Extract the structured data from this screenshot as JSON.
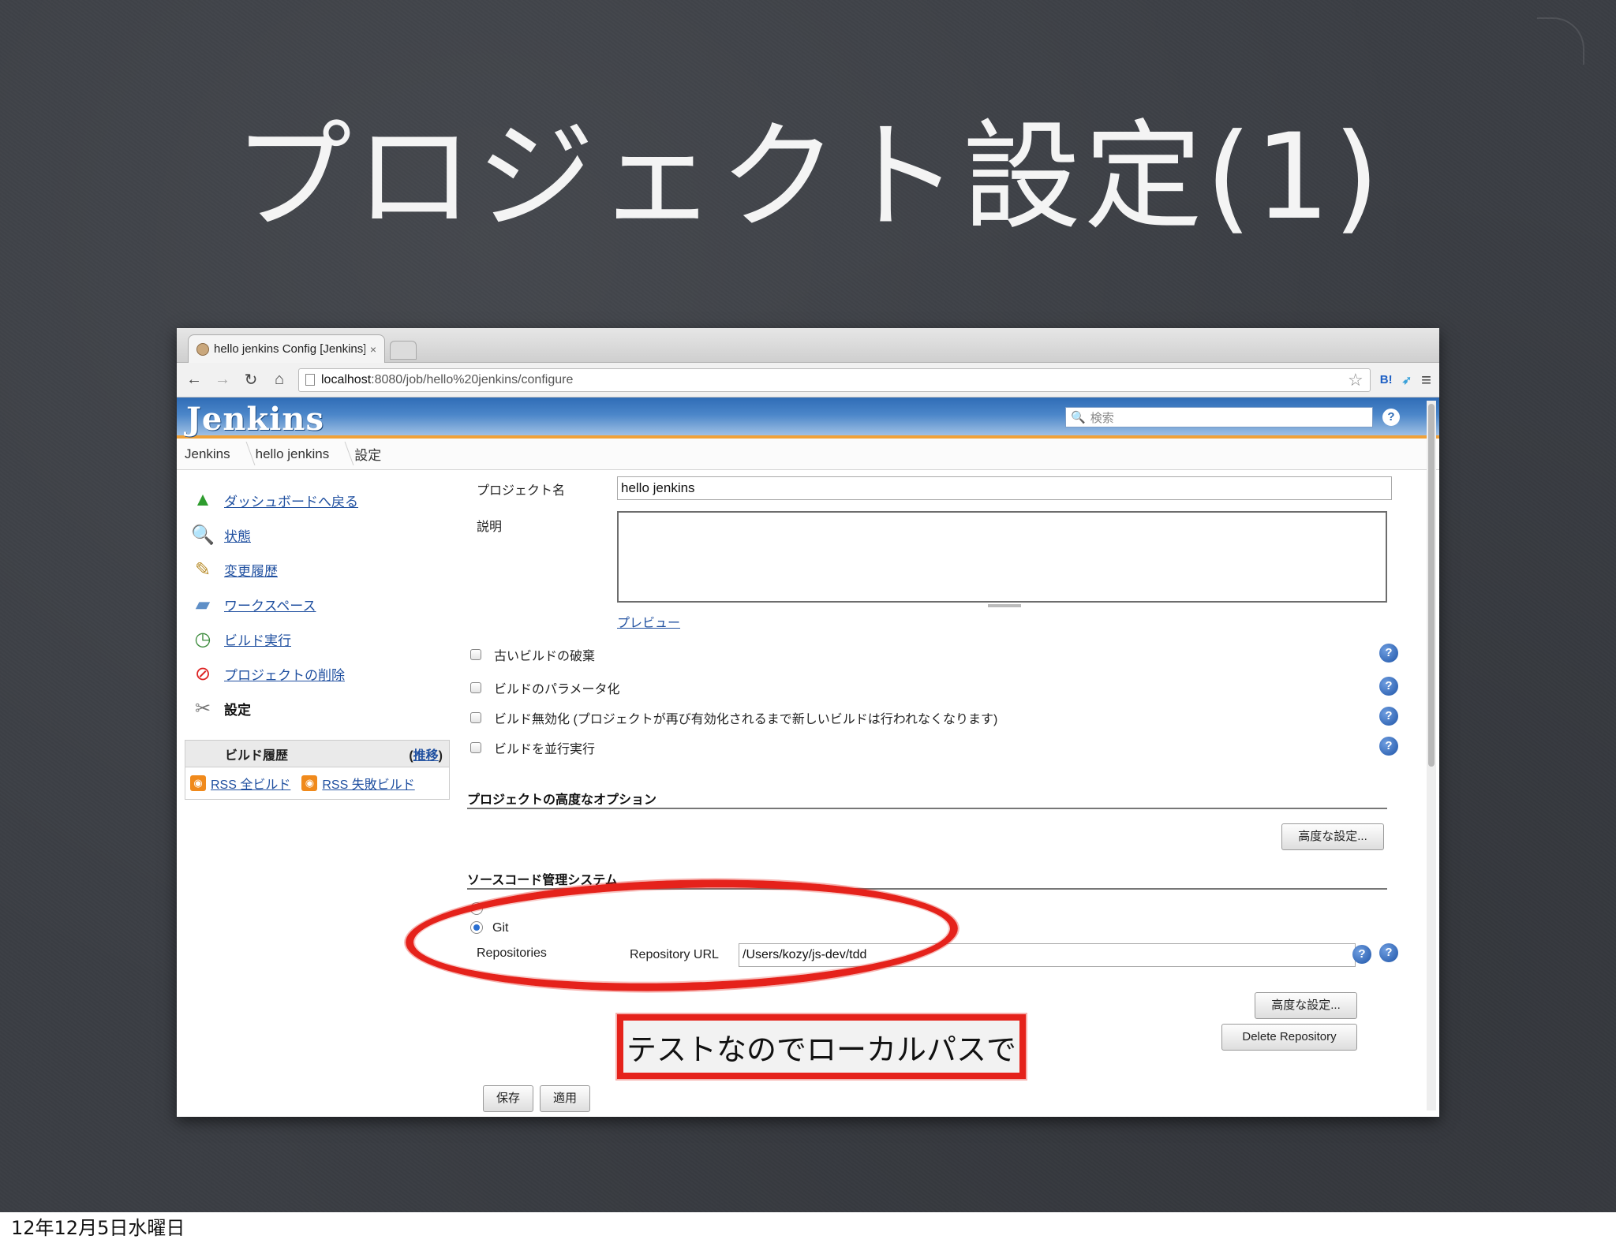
{
  "slide": {
    "title": "プロジェクト設定(1)",
    "footer_date": "12年12月5日水曜日"
  },
  "browser": {
    "tab_title": "hello jenkins Config [Jenkins]",
    "tab_close": "×",
    "url_host": "localhost",
    "url_path": ":8080/job/hello%20jenkins/configure",
    "ext_hatena": "B!",
    "ext_bird": "➶"
  },
  "jenkins": {
    "logo": "Jenkins",
    "search_placeholder": "検索",
    "breadcrumbs": [
      "Jenkins",
      "hello jenkins",
      "設定"
    ],
    "side_items": [
      {
        "label": "ダッシュボードへ戻る",
        "icon": "up-arrow-icon"
      },
      {
        "label": "状態",
        "icon": "search-icon"
      },
      {
        "label": "変更履歴",
        "icon": "notepad-icon"
      },
      {
        "label": "ワークスペース",
        "icon": "folder-icon"
      },
      {
        "label": "ビルド実行",
        "icon": "build-clock-icon"
      },
      {
        "label": "プロジェクトの削除",
        "icon": "no-entry-icon"
      },
      {
        "label": "設定",
        "icon": "tools-icon"
      }
    ],
    "build_history": {
      "title": "ビルド履歴",
      "trend_open": "(",
      "trend": "推移",
      "trend_close": ")",
      "rss_all": "RSS 全ビルド",
      "rss_failed": "RSS 失敗ビルド"
    },
    "form": {
      "project_name_label": "プロジェクト名",
      "project_name_value": "hello jenkins",
      "description_label": "説明",
      "preview": "プレビュー",
      "options": [
        "古いビルドの破棄",
        "ビルドのパラメータ化",
        "ビルド無効化 (プロジェクトが再び有効化されるまで新しいビルドは行われなくなります)",
        "ビルドを並行実行"
      ],
      "advanced_options_head": "プロジェクトの高度なオプション",
      "advanced_button": "高度な設定...",
      "scm_head": "ソースコード管理システム",
      "scm_git": "Git",
      "repositories_label": "Repositories",
      "repo_url_label": "Repository URL",
      "repo_url_value": "/Users/kozy/js-dev/tdd",
      "repo_advanced_button": "高度な設定...",
      "delete_repo_button": "Delete Repository",
      "save_button": "保存",
      "apply_button": "適用"
    },
    "help_glyph": "?"
  },
  "annotation": {
    "callout": "テストなのでローカルパスで"
  },
  "colors": {
    "slide_bg": "#3b3e44",
    "annotation_red": "#e5221b",
    "jenkins_blue": "#2f6cb6",
    "jenkins_orange": "#f0a138",
    "link_blue": "#2050a0"
  }
}
